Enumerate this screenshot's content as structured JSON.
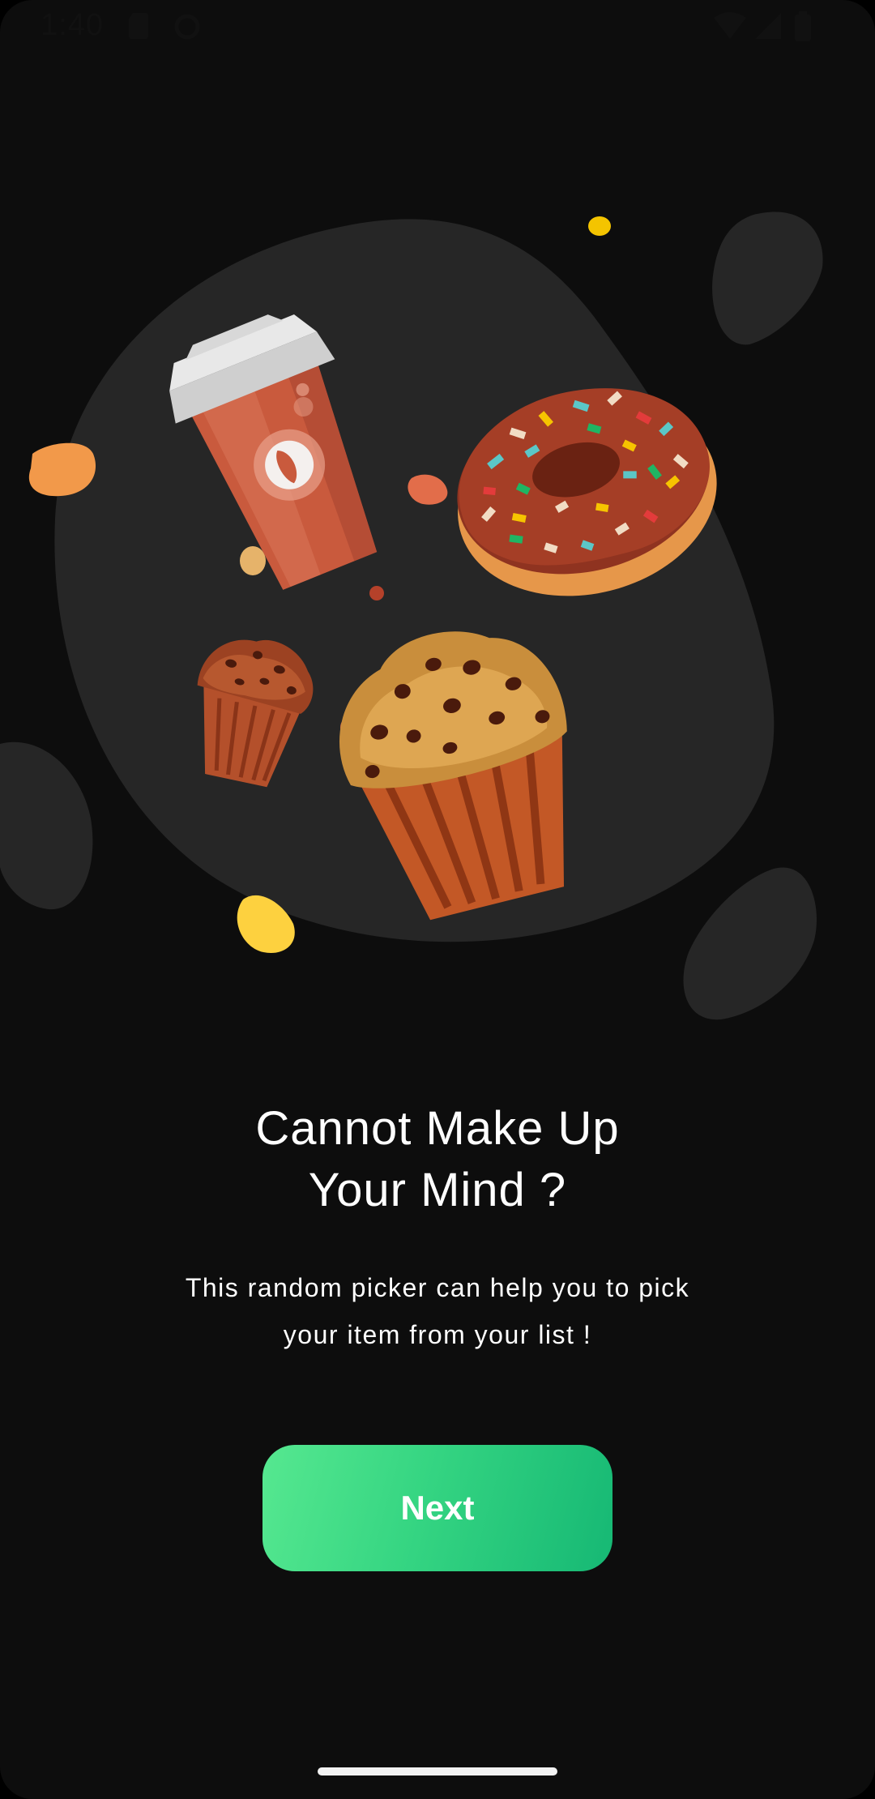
{
  "status_bar": {
    "time": "1:40",
    "icons": [
      "sim-card-icon",
      "sync-icon",
      "wifi-icon",
      "signal-icon",
      "battery-icon"
    ]
  },
  "illustration": {
    "icons": [
      "coffee-cup-icon",
      "donut-icon",
      "small-muffin-icon",
      "large-muffin-icon"
    ]
  },
  "onboarding": {
    "title_line1": "Cannot Make Up",
    "title_line2": "Your Mind ?",
    "subtitle_line1": "This random picker can help you to pick",
    "subtitle_line2": "your item from your list !",
    "next_label": "Next"
  },
  "colors": {
    "background": "#0d0d0d",
    "blob": "#262626",
    "button_start": "#56e890",
    "button_end": "#16b874",
    "text": "#ffffff"
  }
}
